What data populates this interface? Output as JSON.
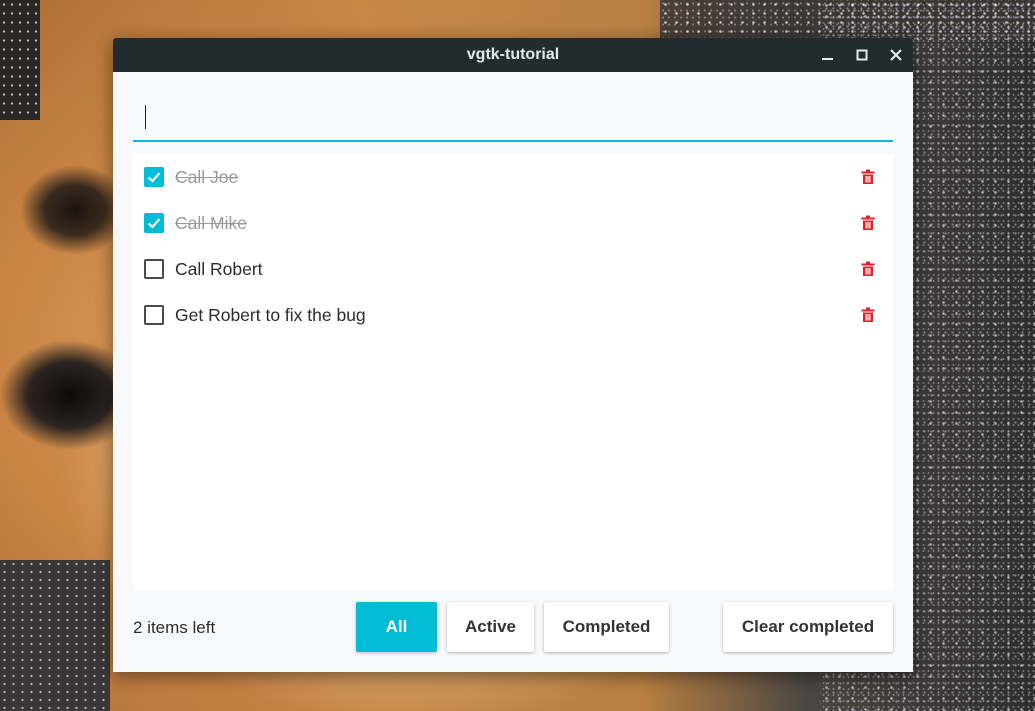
{
  "window": {
    "title": "vgtk-tutorial"
  },
  "entry": {
    "value": "",
    "placeholder": ""
  },
  "todos": [
    {
      "label": "Call Joe",
      "done": true
    },
    {
      "label": "Call Mike",
      "done": true
    },
    {
      "label": "Call Robert",
      "done": false
    },
    {
      "label": "Get Robert to fix the bug",
      "done": false
    }
  ],
  "footer": {
    "items_left": "2 items left",
    "filters": [
      {
        "label": "All",
        "selected": true
      },
      {
        "label": "Active",
        "selected": false
      },
      {
        "label": "Completed",
        "selected": false
      }
    ],
    "clear_label": "Clear completed"
  },
  "colors": {
    "accent": "#00bcd4",
    "delete": "#e0202a",
    "titlebar": "#222b30"
  },
  "icons": {
    "minimize": "minimize-icon",
    "maximize": "maximize-icon",
    "close": "close-icon",
    "delete": "trash-icon",
    "check": "check-icon"
  }
}
